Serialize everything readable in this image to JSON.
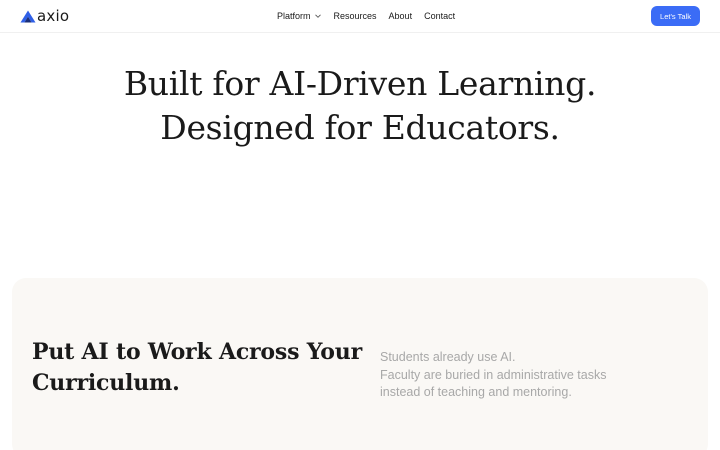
{
  "header": {
    "brand": "axio",
    "nav": [
      "Platform",
      "Resources",
      "About",
      "Contact"
    ],
    "cta_label": "Let's Talk"
  },
  "hero": {
    "line1": "Built for AI-Driven Learning.",
    "line2": "Designed for Educators."
  },
  "feature": {
    "title_line1": "Put AI to Work Across Your",
    "title_line2": "Curriculum.",
    "text_line1": "Students already use AI.",
    "text_line2": "Faculty are buried in administrative tasks",
    "text_line3": "instead of teaching and mentoring."
  },
  "colors": {
    "accent": "#3b6cf6",
    "panel_bg": "#faf8f5",
    "muted_text": "#a8a8a8"
  },
  "icons": {
    "logo": "axio-logo-icon",
    "platform_menu": "chevron-down-icon"
  }
}
